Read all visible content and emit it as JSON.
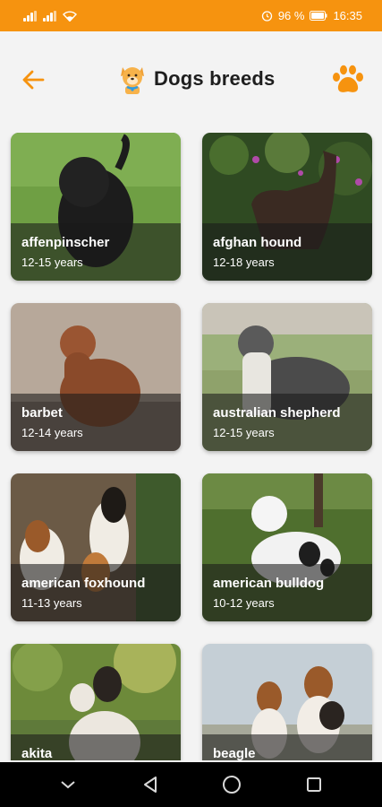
{
  "status": {
    "battery": "96 %",
    "time": "16:35"
  },
  "header": {
    "title": "Dogs breeds",
    "back_icon": "arrow-left-icon",
    "logo_icon": "dog-logo-icon",
    "action_icon": "paw-icon"
  },
  "colors": {
    "accent": "#f6930f",
    "background": "#f3f3f3"
  },
  "breeds": [
    {
      "name": "affenpinscher",
      "years": "12-15 years"
    },
    {
      "name": "afghan hound",
      "years": "12-18 years"
    },
    {
      "name": "barbet",
      "years": "12-14 years"
    },
    {
      "name": "australian shepherd",
      "years": "12-15 years"
    },
    {
      "name": "american foxhound",
      "years": "11-13 years"
    },
    {
      "name": "american bulldog",
      "years": "10-12 years"
    },
    {
      "name": "akita",
      "years": ""
    },
    {
      "name": "beagle",
      "years": ""
    }
  ]
}
